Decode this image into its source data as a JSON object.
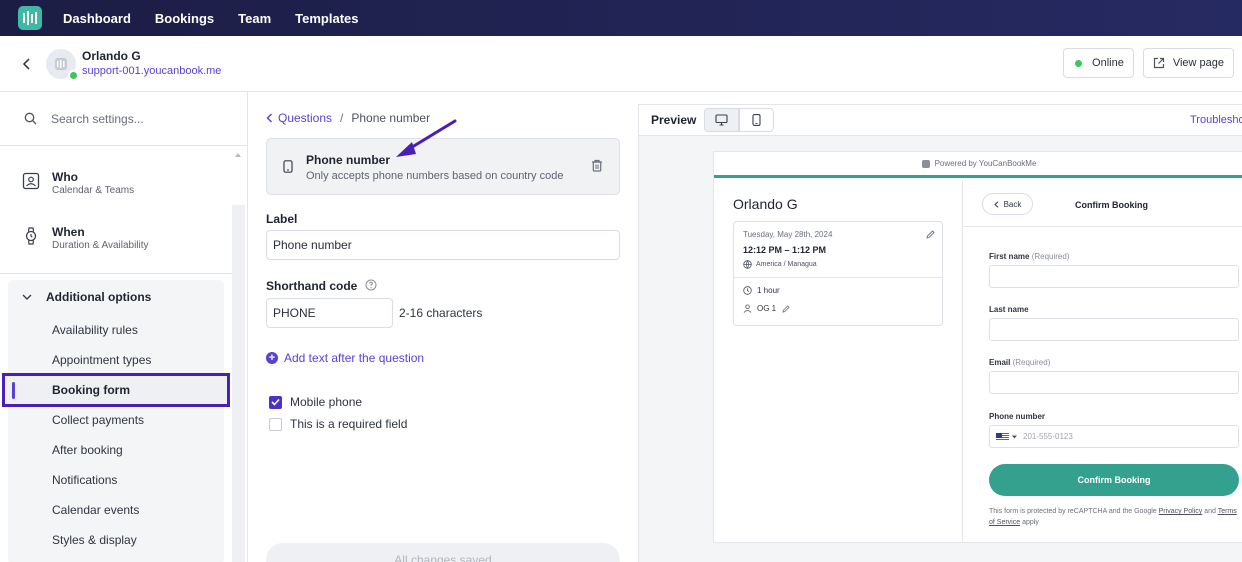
{
  "nav": {
    "items": [
      "Dashboard",
      "Bookings",
      "Team",
      "Templates"
    ]
  },
  "header": {
    "owner_name": "Orlando G",
    "owner_link": "support-001.youcanbook.me",
    "status_label": "Online",
    "view_page_label": "View page"
  },
  "sidebar": {
    "search_placeholder": "Search settings...",
    "sections": [
      {
        "title": "Who",
        "subtitle": "Calendar & Teams",
        "icon": "user-card-icon"
      },
      {
        "title": "When",
        "subtitle": "Duration & Availability",
        "icon": "watch-icon"
      }
    ],
    "group_title": "Additional options",
    "group_items": [
      "Availability rules",
      "Appointment types",
      "Booking form",
      "Collect payments",
      "After booking",
      "Notifications",
      "Calendar events",
      "Styles & display"
    ],
    "active_item": "Booking form"
  },
  "editor": {
    "breadcrumb_parent": "Questions",
    "breadcrumb_separator": "/",
    "breadcrumb_current": "Phone number",
    "question_title": "Phone number",
    "question_description": "Only accepts phone numbers based on country code",
    "label_heading": "Label",
    "label_value": "Phone number",
    "shorthand_heading": "Shorthand code",
    "shorthand_value": "PHONE",
    "shorthand_hint": "2-16 characters",
    "add_text_label": "Add text after the question",
    "checkbox_mobile": {
      "label": "Mobile phone",
      "checked": true
    },
    "checkbox_required": {
      "label": "This is a required field",
      "checked": false
    },
    "save_status": "All changes saved"
  },
  "preview": {
    "title": "Preview",
    "troubleshoot_label": "Troublesho",
    "powered_by": "Powered by YouCanBookMe",
    "owner_name": "Orlando G",
    "date": "Tuesday, May 28th, 2024",
    "time": "12:12 PM – 1:12 PM",
    "timezone": "America / Managua",
    "duration": "1 hour",
    "type": "OG 1",
    "back_label": "Back",
    "confirm_title": "Confirm Booking",
    "fields": {
      "first_name": "First name",
      "last_name": "Last name",
      "email": "Email",
      "phone": "Phone number",
      "required": "(Required)"
    },
    "phone_placeholder": "201-555-0123",
    "confirm_button": "Confirm Booking",
    "legal_prefix": "This form is protected by reCAPTCHA and the Google",
    "legal_privacy": "Privacy Policy",
    "legal_and": "and",
    "legal_terms": "Terms of Service",
    "legal_suffix": "apply"
  },
  "colors": {
    "accent": "#5b3fd1",
    "brand_teal": "#33a18e",
    "nav_bg": "#1c1d45",
    "online_green": "#3bc75c",
    "highlight_box": "#4a1fb8"
  }
}
